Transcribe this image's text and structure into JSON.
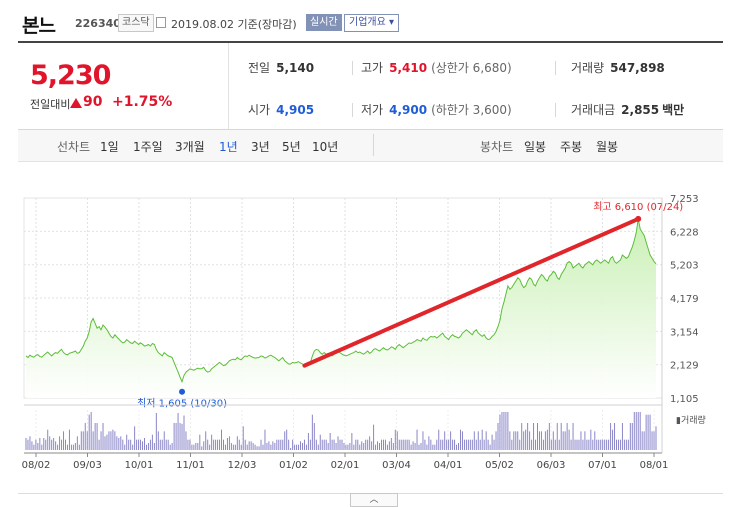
{
  "header": {
    "stock_name": "본느",
    "stock_code": "226340",
    "market_badge": "코스닥",
    "date_text": "2019.08.02 기준(장마감)",
    "realtime_label": "실시간",
    "overview_label": "기업개요 ▾"
  },
  "price": {
    "current": "5,230",
    "diff_label": "전일대비",
    "diff_value": "90",
    "diff_rate": "+1.75%"
  },
  "stats": {
    "prev_close_label": "전일",
    "prev_close": "5,140",
    "high_label": "고가",
    "high": "5,410",
    "upper_limit": "(상한가 6,680)",
    "volume_label": "거래량",
    "volume": "547,898",
    "open_label": "시가",
    "open": "4,905",
    "low_label": "저가",
    "low": "4,900",
    "lower_limit": "(하한가 3,600)",
    "amount_label": "거래대금",
    "amount": "2,855",
    "amount_unit": "백만"
  },
  "periods": {
    "line_label": "선차트",
    "items": [
      "1일",
      "1주일",
      "3개월",
      "1년",
      "3년",
      "5년",
      "10년"
    ],
    "active": "1년",
    "candle_label": "봉차트",
    "candle_items": [
      "일봉",
      "주봉",
      "월봉"
    ]
  },
  "colors": {
    "up": "#e0142b",
    "down": "#1e5cd8",
    "line": "#5dbd3a",
    "area": "#c6efb0",
    "annotation": "#e0262b",
    "volume_bar": "#8a86c8"
  },
  "chart_data": {
    "type": "area",
    "y_ticks": [
      "7,253",
      "6,228",
      "5,203",
      "4,179",
      "3,154",
      "2,129",
      "1,105"
    ],
    "ylim": [
      1105,
      7253
    ],
    "x_ticks": [
      "08/02",
      "09/03",
      "10/01",
      "11/01",
      "12/03",
      "01/02",
      "02/01",
      "03/04",
      "04/01",
      "05/02",
      "06/03",
      "07/01",
      "08/01"
    ],
    "max_annotation": "최고 6,610 (07/24)",
    "min_annotation": "최저 1,605 (10/30)",
    "max_value": 6610,
    "min_value": 1605,
    "volume_label": "거래량",
    "series": [
      {
        "values": [
          2400,
          2350,
          2420,
          2380,
          2360,
          2410,
          2440,
          2380,
          2360,
          2420,
          2470,
          2520,
          2450,
          2400,
          2460,
          2500,
          2480,
          2550,
          2600,
          2500,
          2450,
          2430,
          2480,
          2500,
          2520,
          2550,
          2480,
          2500,
          2600,
          2700,
          2850,
          2950,
          3150,
          3450,
          3550,
          3400,
          3250,
          3300,
          3200,
          3350,
          3280,
          3200,
          3100,
          3000,
          2950,
          3050,
          2980,
          2920,
          2850,
          2800,
          2820,
          2900,
          2850,
          2800,
          2780,
          2850,
          2800,
          2750,
          2800,
          2760,
          2700,
          2720,
          2750,
          2700,
          2780,
          2750,
          2600,
          2500,
          2450,
          2400,
          2500,
          2450,
          2400,
          2380,
          2350,
          2200,
          2050,
          1900,
          1750,
          1605,
          1800,
          1900,
          1950,
          2000,
          1980,
          1960,
          1990,
          2020,
          2000,
          2010,
          2050,
          1950,
          1900,
          1920,
          2000,
          2050,
          2100,
          2150,
          2200,
          2150,
          2100,
          2120,
          2180,
          2250,
          2280,
          2300,
          2280,
          2350,
          2300,
          2280,
          2350,
          2400,
          2380,
          2420,
          2380,
          2350,
          2330,
          2340,
          2350,
          2400,
          2380,
          2330,
          2360,
          2400,
          2420,
          2380,
          2350,
          2300,
          2250,
          2300,
          2350,
          2250,
          2200,
          2150,
          2150,
          2200,
          2180,
          2200,
          2220,
          2180,
          2150,
          2100,
          2120,
          2150,
          2200,
          2400,
          2550,
          2600,
          2580,
          2500,
          2450,
          2500,
          2450,
          2480,
          2450,
          2400,
          2450,
          2480,
          2550,
          2500,
          2450,
          2420,
          2400,
          2420,
          2450,
          2480,
          2500,
          2550,
          2500,
          2520,
          2480,
          2450,
          2500,
          2550,
          2480,
          2520,
          2600,
          2620,
          2580,
          2550,
          2600,
          2650,
          2600,
          2580,
          2620,
          2680,
          2650,
          2600,
          2700,
          2750,
          2700,
          2650,
          2700,
          2750,
          2800,
          2780,
          2820,
          2850,
          2900,
          2880,
          2850,
          2950,
          2900,
          2880,
          2950,
          3000,
          2980,
          3000,
          2950,
          3000,
          3050,
          3100,
          3000,
          2950,
          2900,
          3000,
          3050,
          3000,
          2980,
          2950,
          3000,
          3100,
          3150,
          3200,
          3150,
          3100,
          3050,
          3150,
          3200,
          3100,
          3050,
          3000,
          3050,
          2950,
          2900,
          2920,
          3000,
          3050,
          3150,
          3300,
          3500,
          3850,
          4050,
          4300,
          4550,
          4450,
          4500,
          4600,
          4700,
          4800,
          4750,
          4600,
          4500,
          4550,
          4700,
          4800,
          4750,
          4600,
          4550,
          4700,
          4800,
          4900,
          4850,
          4750,
          4700,
          4850,
          4900,
          5000,
          4950,
          4800,
          4750,
          4900,
          5000,
          5100,
          5250,
          5300,
          5250,
          5100,
          5150,
          5200,
          5250,
          5150,
          5100,
          5200,
          5250,
          5300,
          5250,
          5200,
          5300,
          5350,
          5300,
          5250,
          5300,
          5350,
          5300,
          5250,
          5400,
          5450,
          5300,
          5250,
          5300,
          5350,
          5500,
          5450,
          5400,
          5450,
          5600,
          5750,
          5950,
          6200,
          6610,
          6300,
          6200,
          6100,
          5900,
          5700,
          5500,
          5400,
          5300,
          5230
        ]
      }
    ]
  }
}
